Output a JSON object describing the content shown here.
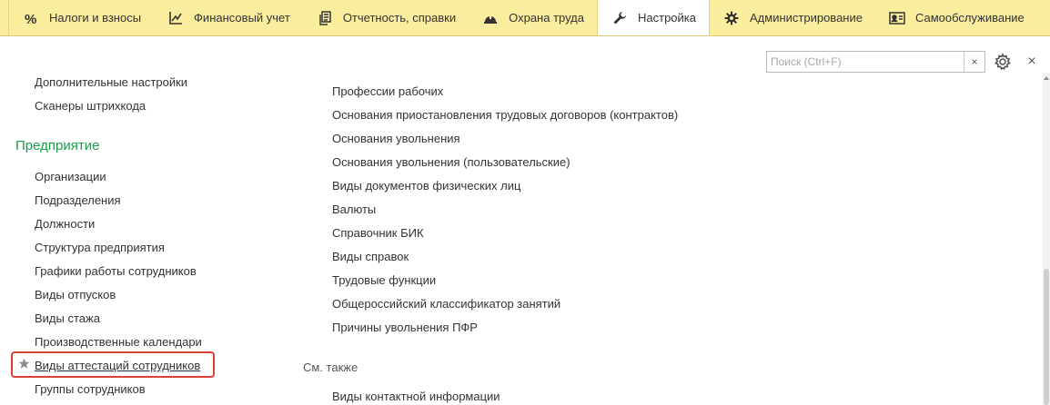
{
  "sections": [
    {
      "id": "taxes",
      "label": "Налоги и взносы",
      "icon": "percent-icon"
    },
    {
      "id": "finance",
      "label": "Финансовый учет",
      "icon": "chart-axis-icon"
    },
    {
      "id": "reports",
      "label": "Отчетность, справки",
      "icon": "documents-icon"
    },
    {
      "id": "labor",
      "label": "Охрана труда",
      "icon": "hard-hat-icon"
    },
    {
      "id": "settings",
      "label": "Настройка",
      "icon": "wrench-icon",
      "active": true
    },
    {
      "id": "admin",
      "label": "Администрирование",
      "icon": "gear-icon"
    },
    {
      "id": "selfservice",
      "label": "Самообслуживание",
      "icon": "id-card-icon"
    }
  ],
  "search": {
    "placeholder": "Поиск (Ctrl+F)",
    "value": "",
    "clear_label": "×"
  },
  "window": {
    "close_label": "×"
  },
  "left": {
    "top_links": [
      "Дополнительные настройки",
      "Сканеры штрихкода"
    ],
    "group_title": "Предприятие",
    "items": [
      "Организации",
      "Подразделения",
      "Должности",
      "Структура предприятия",
      "Графики работы сотрудников",
      "Виды отпусков",
      "Виды стажа",
      "Производственные календари",
      "Виды аттестаций сотрудников",
      "Группы сотрудников"
    ]
  },
  "right": {
    "items": [
      "Профессии рабочих",
      "Основания приостановления трудовых договоров (контрактов)",
      "Основания увольнения",
      "Основания увольнения (пользовательские)",
      "Виды документов физических лиц",
      "Валюты",
      "Справочник БИК",
      "Виды справок",
      "Трудовые функции",
      "Общероссийский классификатор занятий",
      "Причины увольнения ПФР"
    ],
    "see_also_title": "См. также",
    "see_also_items": [
      "Виды контактной информации"
    ]
  },
  "colors": {
    "section_bar": "#fbed9e",
    "group_title": "#1aa04a",
    "highlight_border": "#d9403a"
  }
}
